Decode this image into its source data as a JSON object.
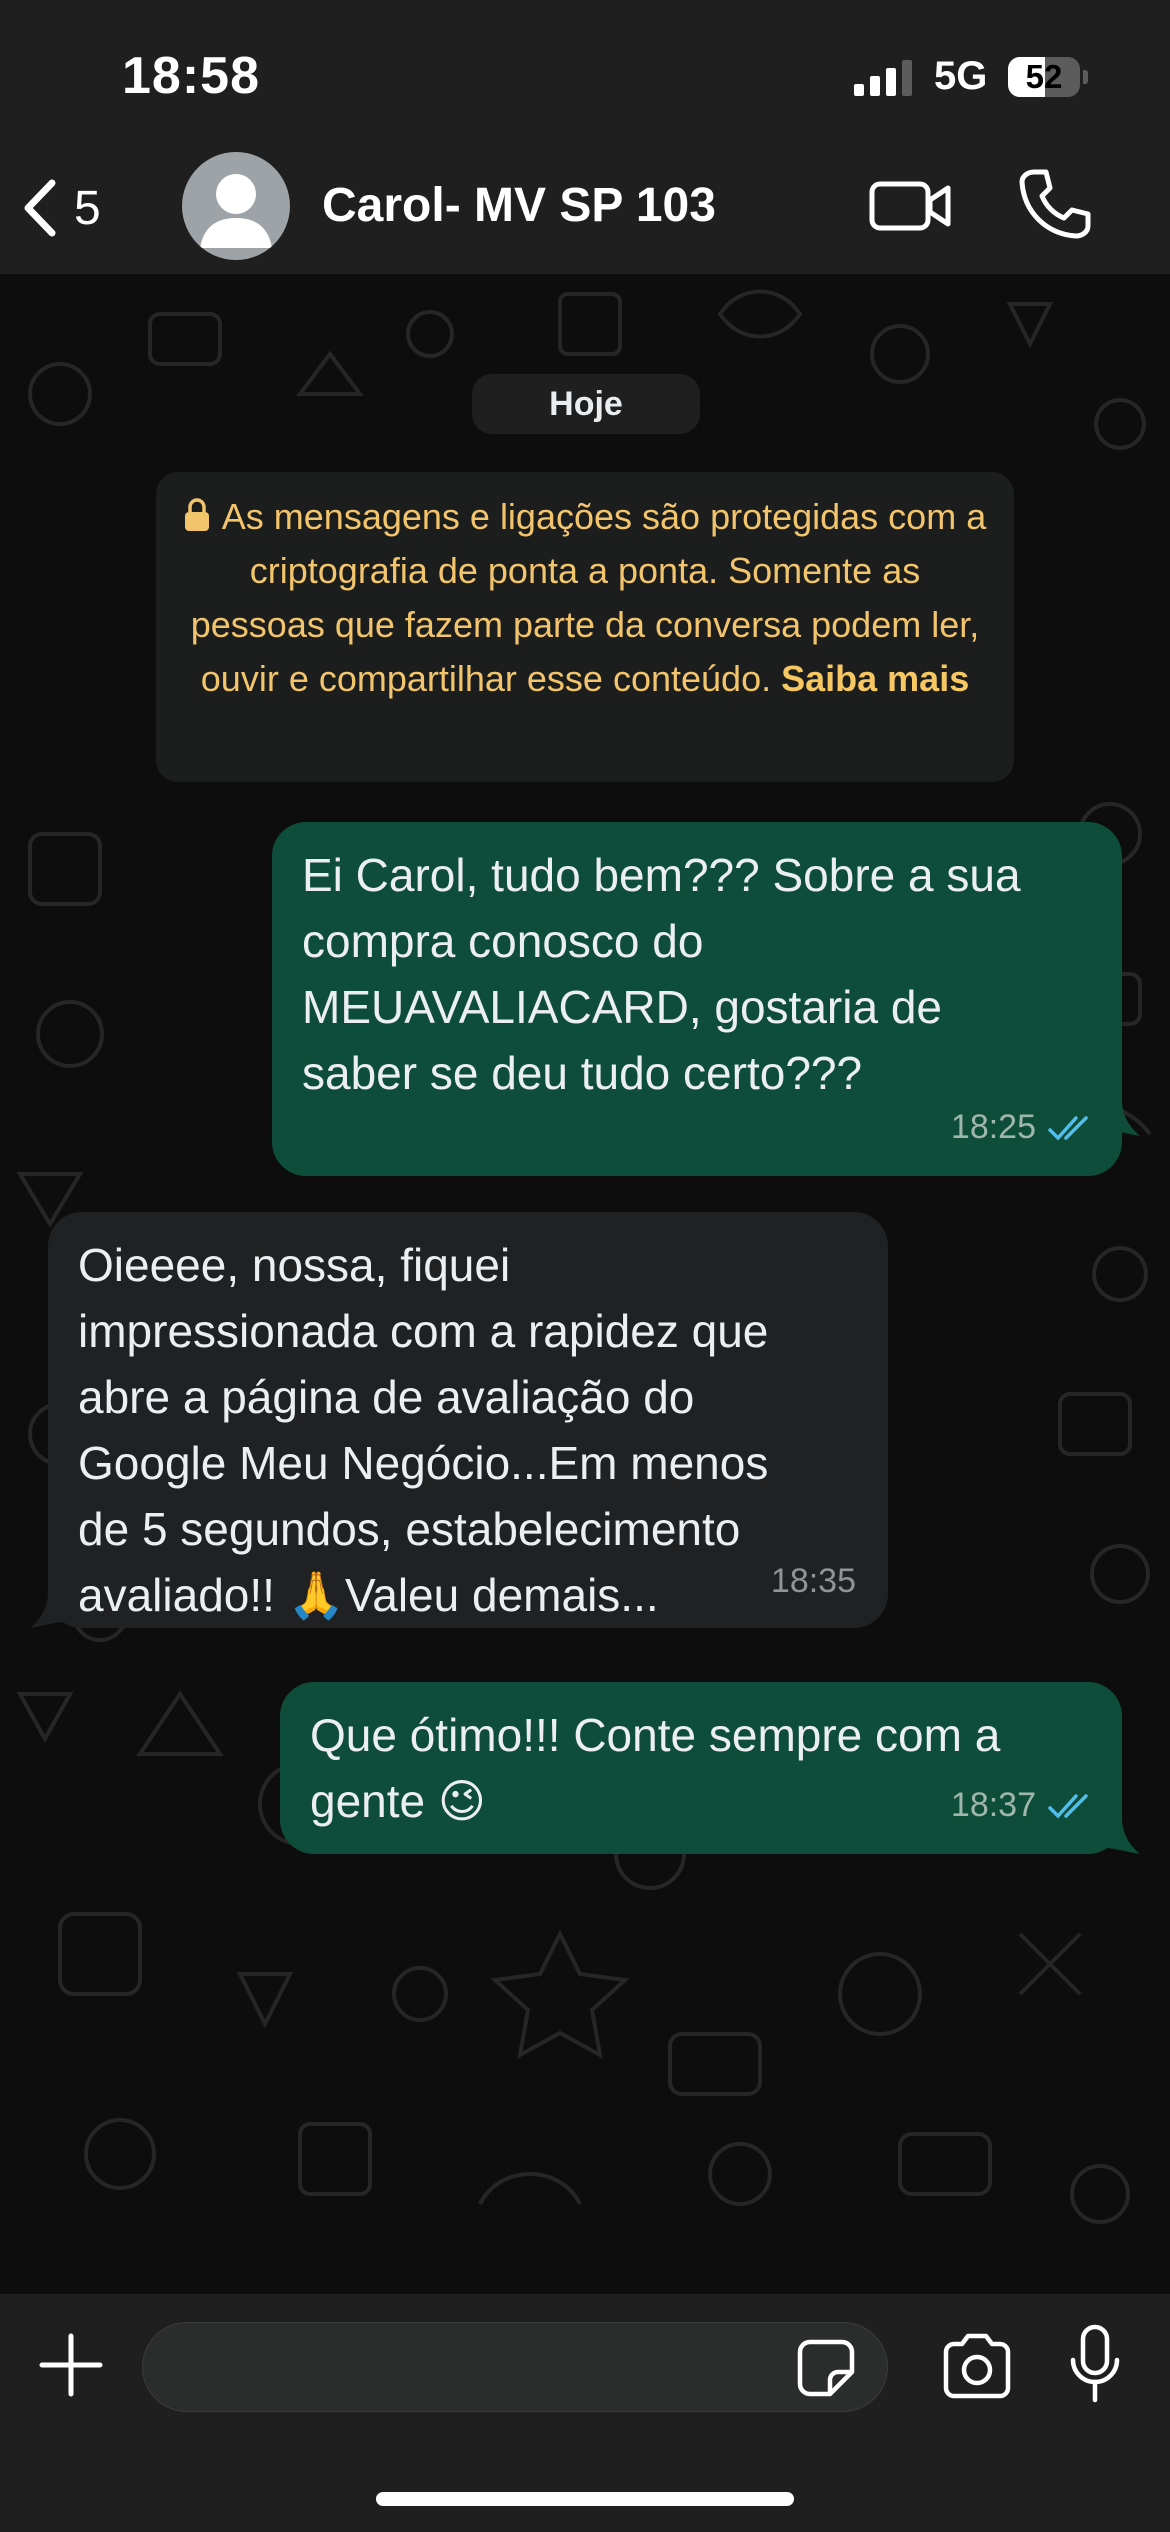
{
  "status_bar": {
    "time": "18:58",
    "network": "5G",
    "battery_level": "52",
    "battery_fraction": 0.52,
    "signal_bars": 3
  },
  "header": {
    "back_count": "5",
    "contact_name": "Carol- MV SP 103"
  },
  "chat": {
    "date_chip": "Hoje",
    "encryption_notice": {
      "text": "As mensagens e ligações são protegidas com a criptografia de ponta a ponta. Somente as pessoas que fazem parte da conversa podem ler, ouvir e compartilhar esse conteúdo.",
      "link": "Saiba mais"
    },
    "messages": [
      {
        "direction": "outgoing",
        "lines": [
          "Ei Carol, tudo bem??? Sobre a sua",
          "compra conosco do",
          "MEUAVALIACARD, gostaria de",
          "saber se deu tudo certo???"
        ],
        "time": "18:25",
        "status": "read"
      },
      {
        "direction": "incoming",
        "lines": [
          "Oieeee, nossa, fiquei",
          "impressionada com a rapidez que",
          "abre a página de avaliação do",
          "Google Meu Negócio...Em menos",
          "de 5 segundos, estabelecimento"
        ],
        "last_line_before_emoji": "avaliado!! ",
        "emoji": "🙏",
        "last_line_after_emoji": "Valeu demais...",
        "time": "18:35"
      },
      {
        "direction": "outgoing",
        "lines": [
          "Que ótimo!!! Conte sempre com a"
        ],
        "last_line_before_emoji": "gente ",
        "emoji": "😉",
        "time": "18:37",
        "status": "read"
      }
    ]
  },
  "colors": {
    "outgoing_bubble": "#0f4d3b",
    "incoming_bubble": "#1f2123",
    "read_ticks": "#53bdeb",
    "notice_text": "#f2c46c"
  }
}
